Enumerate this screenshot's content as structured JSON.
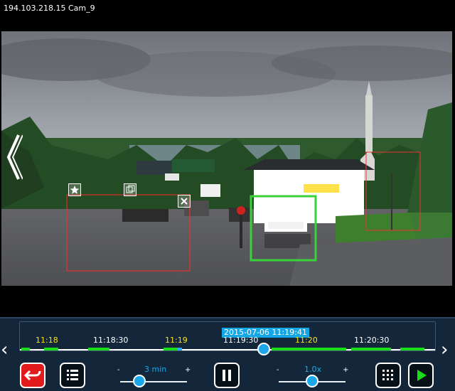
{
  "title": "194.103.218.15 Cam_9",
  "timeline": {
    "current_time": "2015-07-06 11:19:41",
    "ticks": [
      {
        "label": "11:18",
        "color": "yellow"
      },
      {
        "label": "11:18:30",
        "color": "white"
      },
      {
        "label": "11:19",
        "color": "yellow"
      },
      {
        "label": "11:19:30",
        "color": "white"
      },
      {
        "label": "11:20",
        "color": "yellow"
      },
      {
        "label": "11:20:30",
        "color": "white"
      }
    ]
  },
  "controls": {
    "speed_value": "3 min",
    "speed_minus": "-",
    "speed_plus": "+",
    "zoom_value": "1.0x",
    "zoom_minus": "-",
    "zoom_plus": "+"
  },
  "colors": {
    "panel_bg": "#13263a",
    "accent_blue": "#1ba7ea",
    "timeline_green": "#18dd18",
    "timeline_blue": "#2fa8ff"
  },
  "icons": {
    "left_nav": "left-chevron-icon",
    "right_nav": "right-chevron-icon",
    "undo": "undo-icon",
    "list": "list-icon",
    "pause": "pause-icon",
    "grid": "grid-icon",
    "play": "play-icon",
    "back": "left-double-chevron-icon",
    "star": "star-icon",
    "copy": "copy-icon",
    "close": "close-icon"
  }
}
